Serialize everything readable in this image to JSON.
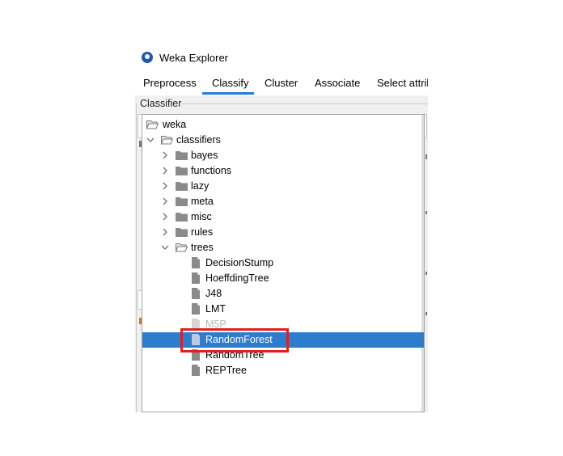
{
  "window": {
    "title": "Weka Explorer",
    "icon": "weka-bird-icon"
  },
  "tabs": [
    {
      "label": "Preprocess",
      "active": false
    },
    {
      "label": "Classify",
      "active": true
    },
    {
      "label": "Cluster",
      "active": false
    },
    {
      "label": "Associate",
      "active": false
    },
    {
      "label": "Select attrib",
      "active": false
    }
  ],
  "classifier_group": {
    "label": "Classifier"
  },
  "tree": {
    "root": {
      "label": "weka"
    },
    "classifiers": {
      "label": "classifiers"
    },
    "folders": [
      {
        "label": "bayes"
      },
      {
        "label": "functions"
      },
      {
        "label": "lazy"
      },
      {
        "label": "meta"
      },
      {
        "label": "misc"
      },
      {
        "label": "rules"
      },
      {
        "label": "trees"
      }
    ],
    "tree_items": [
      {
        "label": "DecisionStump",
        "enabled": true,
        "selected": false
      },
      {
        "label": "HoeffdingTree",
        "enabled": true,
        "selected": false
      },
      {
        "label": "J48",
        "enabled": true,
        "selected": false
      },
      {
        "label": "LMT",
        "enabled": true,
        "selected": false
      },
      {
        "label": "M5P",
        "enabled": false,
        "selected": false
      },
      {
        "label": "RandomForest",
        "enabled": true,
        "selected": true
      },
      {
        "label": "RandomTree",
        "enabled": true,
        "selected": false
      },
      {
        "label": "REPTree",
        "enabled": true,
        "selected": false
      }
    ]
  },
  "colors": {
    "selection": "#2f7bce",
    "tab_accent": "#2a7ad8",
    "highlight_box": "#e02020",
    "disabled_text": "#b8b8b8"
  }
}
